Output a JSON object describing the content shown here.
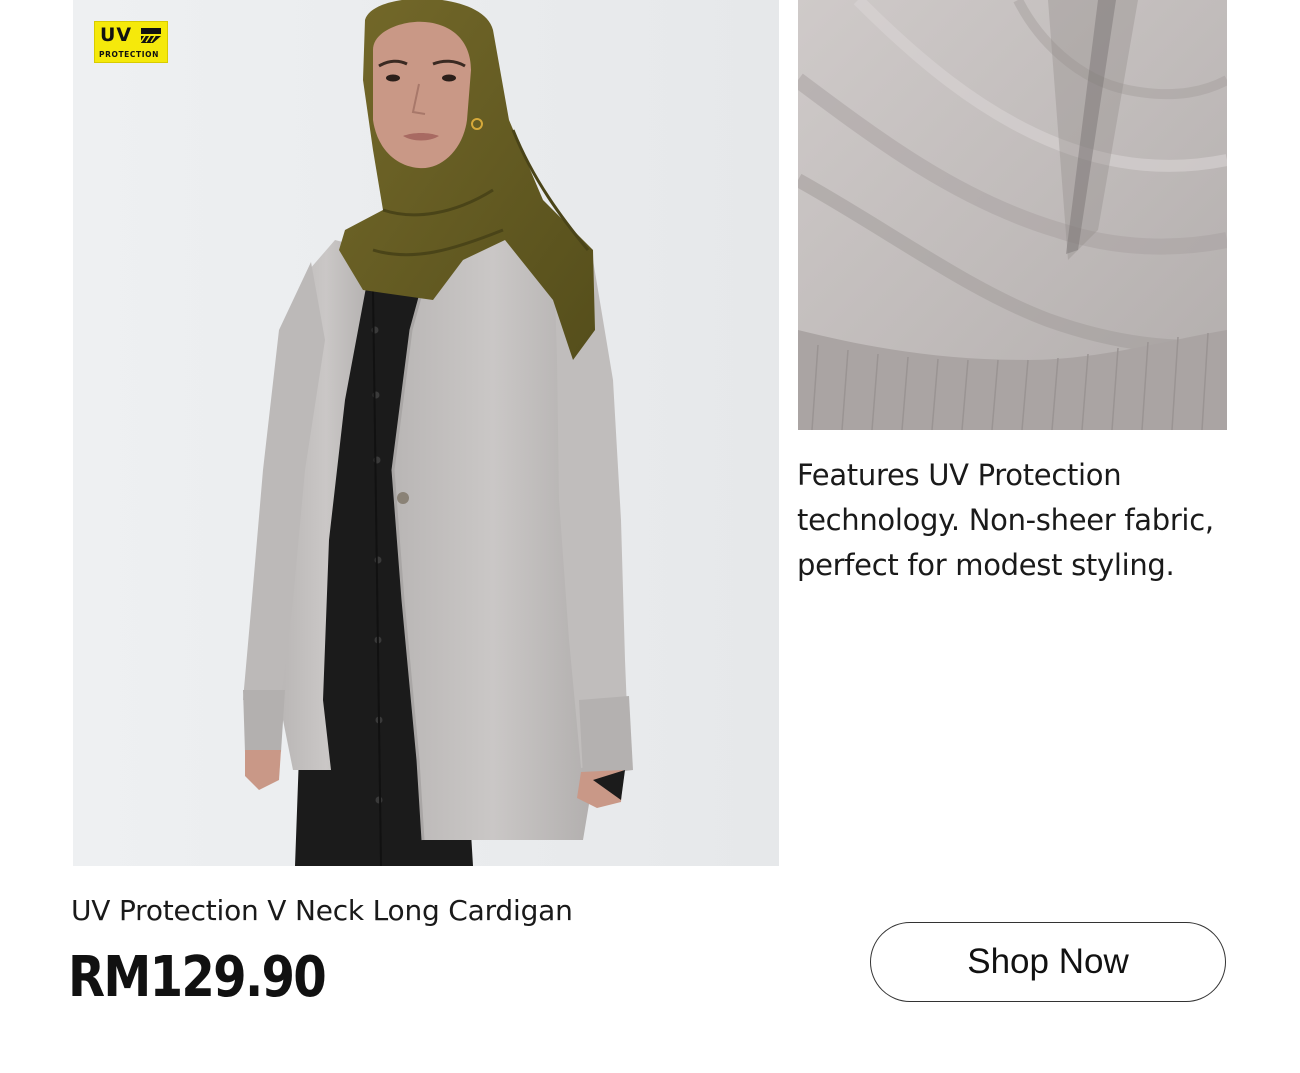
{
  "badge": {
    "main": "UV",
    "sub": "PROTECTION",
    "icon": "uv-protection-icon",
    "color": "#f5e90b"
  },
  "images": {
    "main": "model-wearing-grey-cardigan-photo",
    "fabric": "fabric-closeup-photo"
  },
  "feature": {
    "lines": [
      "Features UV Protection",
      "technology. Non-sheer fabric,",
      "perfect for modest styling."
    ]
  },
  "product": {
    "name": "UV Protection V Neck Long Cardigan",
    "price": "RM129.90"
  },
  "cta": {
    "label": "Shop Now"
  },
  "colors": {
    "cardigan": "#c4c1c0",
    "hijab": "#6a6222",
    "dress": "#1b1b1b",
    "background": "#eceef0",
    "accent": "#f5e90b"
  }
}
